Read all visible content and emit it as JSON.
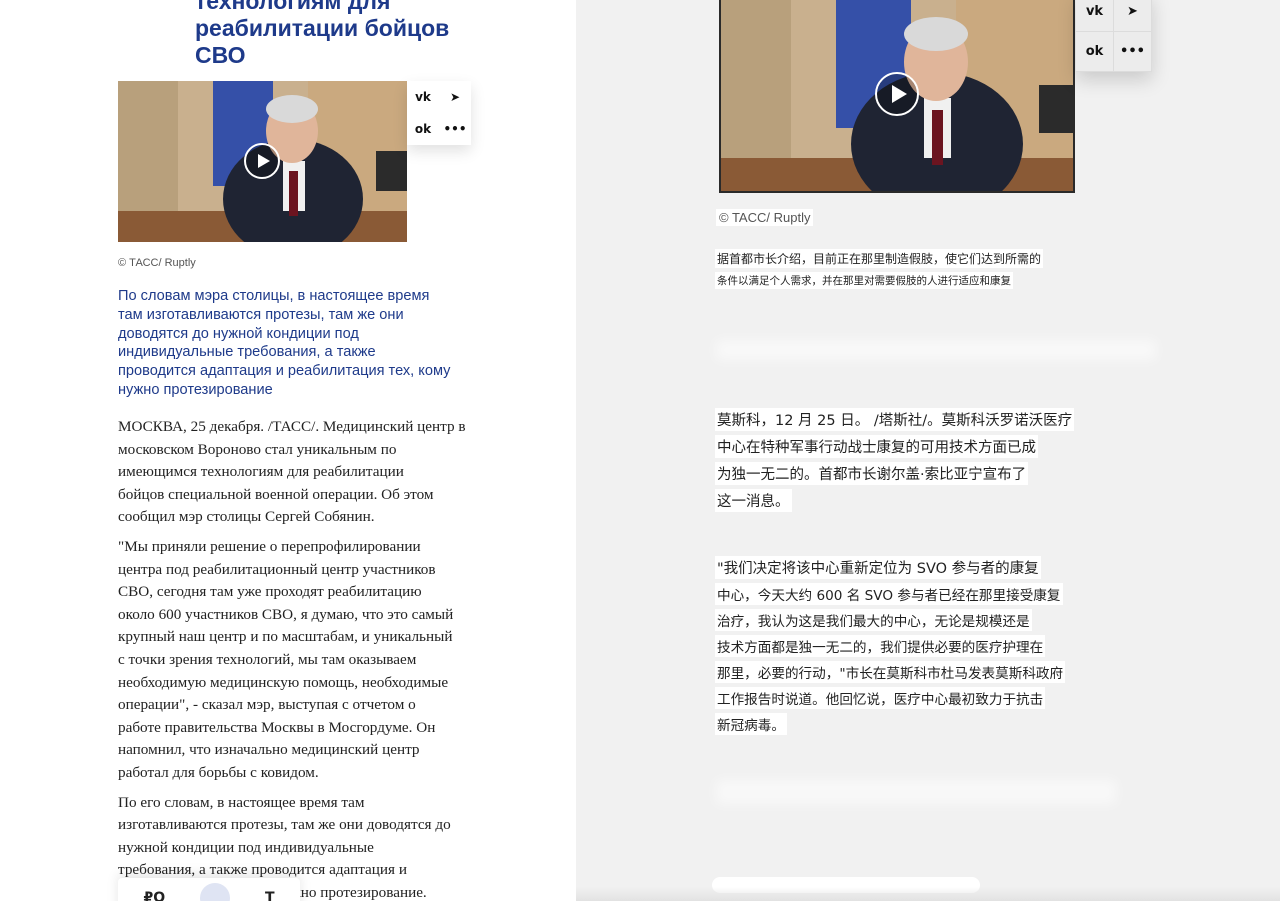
{
  "left": {
    "headline_lines": [
      "технологиям для",
      "реабилитации бойцов",
      "СВО"
    ],
    "share_icons": [
      "vk-icon",
      "telegram-icon",
      "odnoklassniki-icon",
      "more-icon"
    ],
    "share_glyphs": [
      "vk",
      "➤",
      "ok",
      "•••"
    ],
    "credit": "© ТАСС/ Ruptly",
    "lead_lines": [
      "По словам мэра столицы, в настоящее время",
      "там изготавливаются протезы, там же они",
      "доводятся до нужной кондиции под",
      "индивидуальные требования, а также",
      "проводится адаптация и реабилитация тех, кому",
      "нужно протезирование"
    ],
    "paragraphs": [
      [
        "МОСКВА, 25 декабря. /ТАСС/. Медицинский центр в",
        "московском Вороново стал уникальным по",
        "имеющимся технологиям для реабилитации",
        "бойцов специальной военной операции. Об этом",
        "сообщил мэр столицы Сергей Собянин."
      ],
      [
        "\"Мы приняли решение о перепрофилировании",
        "центра под реабилитационный центр участников",
        "СВО, сегодня там уже проходят реабилитацию",
        "около 600 участников СВО, я думаю, что это самый",
        "крупный наш центр и по масштабам, и уникальный",
        "с точки зрения технологий, мы там оказываем",
        "необходимую медицинскую помощь, необходимые",
        "операции\", - сказал мэр, выступая с отчетом о",
        "работе правительства Москвы в Мосгордуме. Он",
        "напомнил, что изначально медицинский центр",
        "работал для борьбы с ковидом."
      ],
      [
        "По его словам, в настоящее время там",
        "изготавливаются протезы, там же они доводятся до",
        "нужной кондиции под индивидуальные",
        "требования, а также проводится адаптация и",
        "реабилитация тех, кому нужно протезирование."
      ]
    ],
    "toolbar_glyphs": [
      "₽O",
      "",
      "T"
    ]
  },
  "right": {
    "share_icons": [
      "vk-icon",
      "telegram-icon",
      "odnoklassniki-icon",
      "more-icon"
    ],
    "share_glyphs": [
      "vk",
      "➤",
      "ok",
      "•••"
    ],
    "credit": "© TACC/ Ruptly",
    "lead_lines": [
      "据首都市长介绍，目前正在那里制造假肢，使它们达到所需的",
      "条件以满足个人需求，并在那里对需要假肢的人进行适应和康复"
    ],
    "p1_lines": [
      "莫斯科，12 月 25 日。 /塔斯社/。莫斯科沃罗诺沃医疗",
      "中心在特种军事行动战士康复的可用技术方面已成",
      "为独一无二的。首都市长谢尔盖·索比亚宁宣布了",
      "这一消息。"
    ],
    "p2_lines": [
      "\"我们决定将该中心重新定位为 SVO 参与者的康复",
      "中心，今天大约 600 名 SVO 参与者已经在那里接受康复",
      "治疗，我认为这是我们最大的中心，无论是规模还是",
      "技术方面都是独一无二的，我们提供必要的医疗护理在",
      "那里，必要的行动，\"市长在莫斯科市杜马发表莫斯科政府",
      "工作报告时说道。他回忆说，医疗中心最初致力于抗击",
      "新冠病毒。"
    ]
  },
  "colors": {
    "accent": "#1e3a8a",
    "right_bg": "#f1f1f1"
  }
}
